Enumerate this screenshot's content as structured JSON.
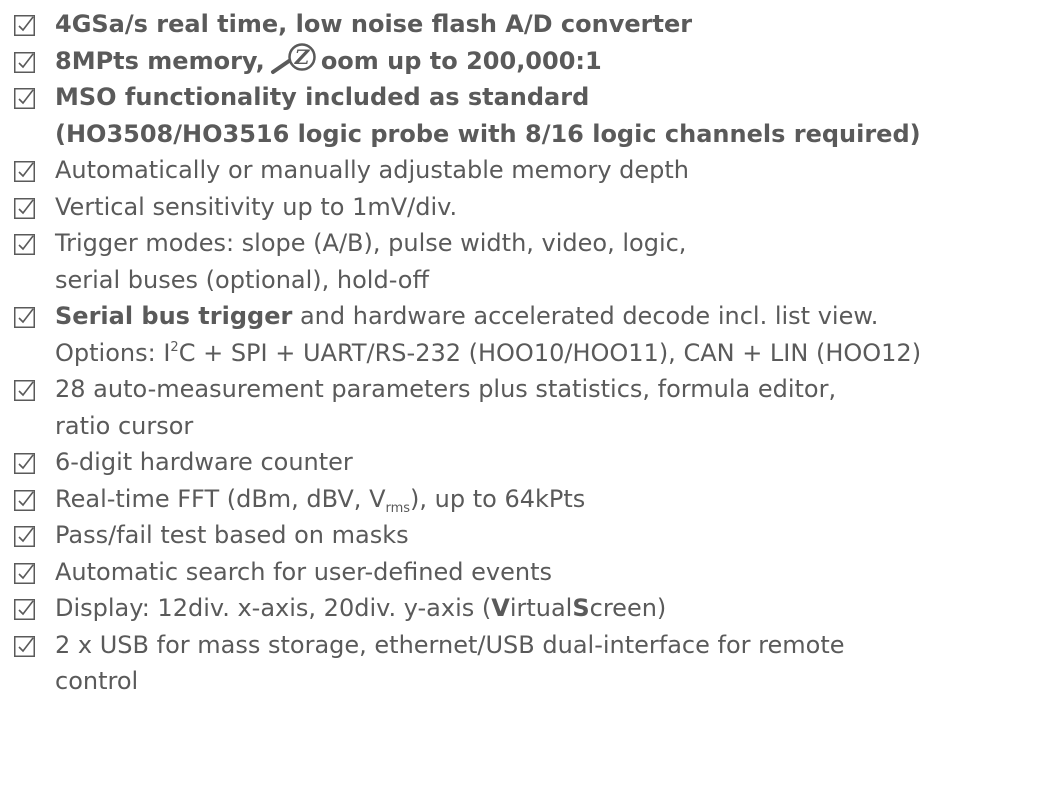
{
  "colors": {
    "text": "#5a5a5a",
    "checkbox": "#5a5a5a"
  },
  "icons": {
    "checkbox": "checked-box-icon",
    "zoom": "magnifier-z-icon"
  },
  "items": [
    {
      "line1": "4GSa/s real time, low noise flash A/D converter"
    },
    {
      "prefix": "8MPts memory,",
      "zoom_letter": "Z",
      "suffix": "oom up to 200,000:1"
    },
    {
      "line1": "MSO functionality included as standard",
      "line2": "(HO3508/HO3516 logic probe with 8/16 logic channels required)"
    },
    {
      "line1": "Automatically or manually adjustable memory depth"
    },
    {
      "line1": "Vertical sensitivity up to 1mV/div."
    },
    {
      "line1": "Trigger modes: slope (A/B), pulse width, video, logic,",
      "line2": "serial buses (optional), hold-off"
    },
    {
      "bold_part": "Serial bus trigger",
      "rest": " and hardware accelerated decode incl. list view.",
      "line2_a": "Options: I",
      "line2_sup": "2",
      "line2_b": "C + SPI + UART/RS-232 (HOO10/HOO11), CAN + LIN (HOO12)"
    },
    {
      "line1": "28 auto-measurement parameters plus statistics, formula editor,",
      "line2": "ratio cursor"
    },
    {
      "line1": "6-digit hardware counter"
    },
    {
      "part_a": "Real-time FFT (dBm, dBV, V",
      "sub": "rms",
      "part_b": "), up to 64kPts"
    },
    {
      "line1": "Pass/fail test based on masks"
    },
    {
      "line1": "Automatic search for user-defined events"
    },
    {
      "part_a": "Display: 12div. x-axis, 20div. y-axis (",
      "v": "V",
      "irtual": "irtual",
      "s": "S",
      "creen": "creen",
      "close": ")"
    },
    {
      "line1": "2 x USB for mass storage, ethernet/USB dual-interface for remote",
      "line2": "control"
    }
  ]
}
